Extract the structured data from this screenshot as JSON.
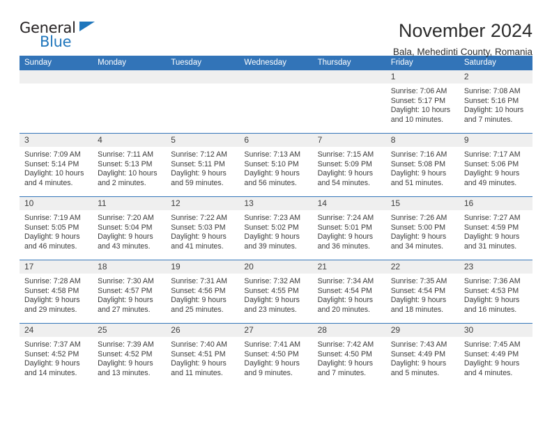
{
  "brand": {
    "word1": "General",
    "word2": "Blue",
    "accent_color": "#1f76bc"
  },
  "header": {
    "title": "November 2024",
    "subtitle": "Bala, Mehedinti County, Romania"
  },
  "calendar": {
    "header_bg": "#3274b8",
    "daynum_band_bg": "#efefef",
    "weekdays": [
      "Sunday",
      "Monday",
      "Tuesday",
      "Wednesday",
      "Thursday",
      "Friday",
      "Saturday"
    ],
    "labels": {
      "sunrise": "Sunrise:",
      "sunset": "Sunset:",
      "daylight": "Daylight:"
    },
    "weeks": [
      [
        {
          "day": "",
          "empty": true
        },
        {
          "day": "",
          "empty": true
        },
        {
          "day": "",
          "empty": true
        },
        {
          "day": "",
          "empty": true
        },
        {
          "day": "",
          "empty": true
        },
        {
          "day": "1",
          "sunrise": "Sunrise: 7:06 AM",
          "sunset": "Sunset: 5:17 PM",
          "daylight": "Daylight: 10 hours and 10 minutes."
        },
        {
          "day": "2",
          "sunrise": "Sunrise: 7:08 AM",
          "sunset": "Sunset: 5:16 PM",
          "daylight": "Daylight: 10 hours and 7 minutes."
        }
      ],
      [
        {
          "day": "3",
          "sunrise": "Sunrise: 7:09 AM",
          "sunset": "Sunset: 5:14 PM",
          "daylight": "Daylight: 10 hours and 4 minutes."
        },
        {
          "day": "4",
          "sunrise": "Sunrise: 7:11 AM",
          "sunset": "Sunset: 5:13 PM",
          "daylight": "Daylight: 10 hours and 2 minutes."
        },
        {
          "day": "5",
          "sunrise": "Sunrise: 7:12 AM",
          "sunset": "Sunset: 5:11 PM",
          "daylight": "Daylight: 9 hours and 59 minutes."
        },
        {
          "day": "6",
          "sunrise": "Sunrise: 7:13 AM",
          "sunset": "Sunset: 5:10 PM",
          "daylight": "Daylight: 9 hours and 56 minutes."
        },
        {
          "day": "7",
          "sunrise": "Sunrise: 7:15 AM",
          "sunset": "Sunset: 5:09 PM",
          "daylight": "Daylight: 9 hours and 54 minutes."
        },
        {
          "day": "8",
          "sunrise": "Sunrise: 7:16 AM",
          "sunset": "Sunset: 5:08 PM",
          "daylight": "Daylight: 9 hours and 51 minutes."
        },
        {
          "day": "9",
          "sunrise": "Sunrise: 7:17 AM",
          "sunset": "Sunset: 5:06 PM",
          "daylight": "Daylight: 9 hours and 49 minutes."
        }
      ],
      [
        {
          "day": "10",
          "sunrise": "Sunrise: 7:19 AM",
          "sunset": "Sunset: 5:05 PM",
          "daylight": "Daylight: 9 hours and 46 minutes."
        },
        {
          "day": "11",
          "sunrise": "Sunrise: 7:20 AM",
          "sunset": "Sunset: 5:04 PM",
          "daylight": "Daylight: 9 hours and 43 minutes."
        },
        {
          "day": "12",
          "sunrise": "Sunrise: 7:22 AM",
          "sunset": "Sunset: 5:03 PM",
          "daylight": "Daylight: 9 hours and 41 minutes."
        },
        {
          "day": "13",
          "sunrise": "Sunrise: 7:23 AM",
          "sunset": "Sunset: 5:02 PM",
          "daylight": "Daylight: 9 hours and 39 minutes."
        },
        {
          "day": "14",
          "sunrise": "Sunrise: 7:24 AM",
          "sunset": "Sunset: 5:01 PM",
          "daylight": "Daylight: 9 hours and 36 minutes."
        },
        {
          "day": "15",
          "sunrise": "Sunrise: 7:26 AM",
          "sunset": "Sunset: 5:00 PM",
          "daylight": "Daylight: 9 hours and 34 minutes."
        },
        {
          "day": "16",
          "sunrise": "Sunrise: 7:27 AM",
          "sunset": "Sunset: 4:59 PM",
          "daylight": "Daylight: 9 hours and 31 minutes."
        }
      ],
      [
        {
          "day": "17",
          "sunrise": "Sunrise: 7:28 AM",
          "sunset": "Sunset: 4:58 PM",
          "daylight": "Daylight: 9 hours and 29 minutes."
        },
        {
          "day": "18",
          "sunrise": "Sunrise: 7:30 AM",
          "sunset": "Sunset: 4:57 PM",
          "daylight": "Daylight: 9 hours and 27 minutes."
        },
        {
          "day": "19",
          "sunrise": "Sunrise: 7:31 AM",
          "sunset": "Sunset: 4:56 PM",
          "daylight": "Daylight: 9 hours and 25 minutes."
        },
        {
          "day": "20",
          "sunrise": "Sunrise: 7:32 AM",
          "sunset": "Sunset: 4:55 PM",
          "daylight": "Daylight: 9 hours and 23 minutes."
        },
        {
          "day": "21",
          "sunrise": "Sunrise: 7:34 AM",
          "sunset": "Sunset: 4:54 PM",
          "daylight": "Daylight: 9 hours and 20 minutes."
        },
        {
          "day": "22",
          "sunrise": "Sunrise: 7:35 AM",
          "sunset": "Sunset: 4:54 PM",
          "daylight": "Daylight: 9 hours and 18 minutes."
        },
        {
          "day": "23",
          "sunrise": "Sunrise: 7:36 AM",
          "sunset": "Sunset: 4:53 PM",
          "daylight": "Daylight: 9 hours and 16 minutes."
        }
      ],
      [
        {
          "day": "24",
          "sunrise": "Sunrise: 7:37 AM",
          "sunset": "Sunset: 4:52 PM",
          "daylight": "Daylight: 9 hours and 14 minutes."
        },
        {
          "day": "25",
          "sunrise": "Sunrise: 7:39 AM",
          "sunset": "Sunset: 4:52 PM",
          "daylight": "Daylight: 9 hours and 13 minutes."
        },
        {
          "day": "26",
          "sunrise": "Sunrise: 7:40 AM",
          "sunset": "Sunset: 4:51 PM",
          "daylight": "Daylight: 9 hours and 11 minutes."
        },
        {
          "day": "27",
          "sunrise": "Sunrise: 7:41 AM",
          "sunset": "Sunset: 4:50 PM",
          "daylight": "Daylight: 9 hours and 9 minutes."
        },
        {
          "day": "28",
          "sunrise": "Sunrise: 7:42 AM",
          "sunset": "Sunset: 4:50 PM",
          "daylight": "Daylight: 9 hours and 7 minutes."
        },
        {
          "day": "29",
          "sunrise": "Sunrise: 7:43 AM",
          "sunset": "Sunset: 4:49 PM",
          "daylight": "Daylight: 9 hours and 5 minutes."
        },
        {
          "day": "30",
          "sunrise": "Sunrise: 7:45 AM",
          "sunset": "Sunset: 4:49 PM",
          "daylight": "Daylight: 9 hours and 4 minutes."
        }
      ]
    ]
  }
}
